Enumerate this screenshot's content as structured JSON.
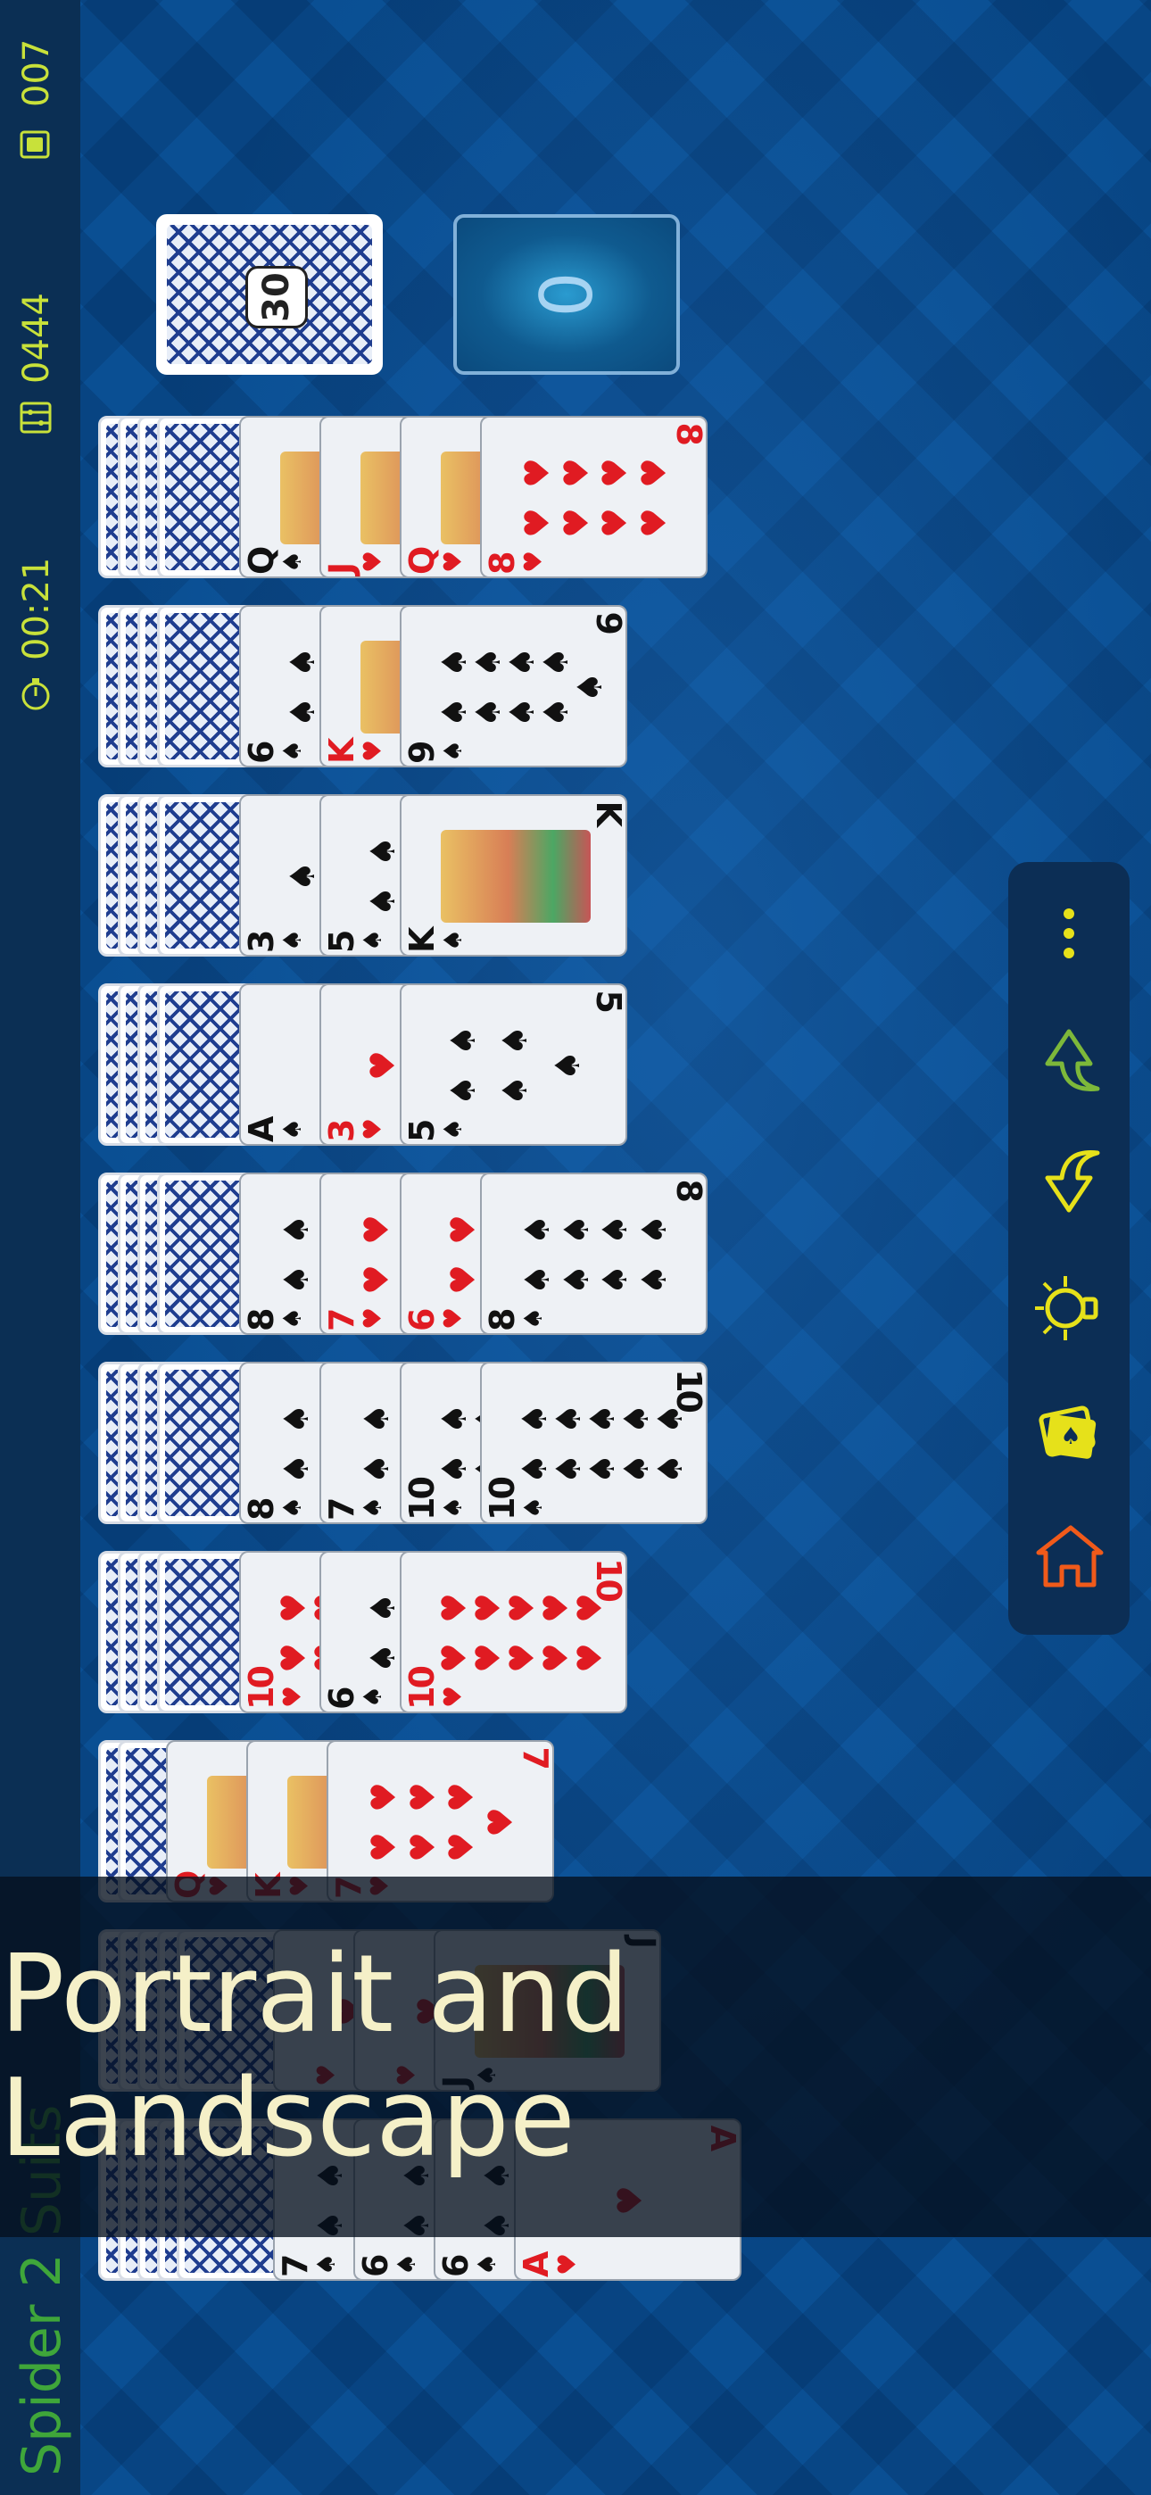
{
  "status": {
    "moves": "007",
    "score": "0444",
    "time": "00:21",
    "game_title": "Spider 2 Suits",
    "moves_icon": "cards-icon",
    "score_icon": "abacus-icon",
    "time_icon": "stopwatch-icon"
  },
  "stock": {
    "count": "30"
  },
  "foundation": {
    "count": "0"
  },
  "tableau": [
    {
      "hidden": 4,
      "face_up": [
        {
          "rank": "Q",
          "suit": "♠",
          "color": "black",
          "court": true
        },
        {
          "rank": "J",
          "suit": "♥",
          "color": "red",
          "court": true
        },
        {
          "rank": "Q",
          "suit": "♥",
          "color": "red",
          "court": true
        },
        {
          "rank": "8",
          "suit": "♥",
          "color": "red"
        }
      ]
    },
    {
      "hidden": 4,
      "face_up": [
        {
          "rank": "6",
          "suit": "♠",
          "color": "black"
        },
        {
          "rank": "K",
          "suit": "♥",
          "color": "red",
          "court": true
        },
        {
          "rank": "9",
          "suit": "♠",
          "color": "black"
        }
      ]
    },
    {
      "hidden": 4,
      "face_up": [
        {
          "rank": "3",
          "suit": "♠",
          "color": "black"
        },
        {
          "rank": "5",
          "suit": "♠",
          "color": "black"
        },
        {
          "rank": "K",
          "suit": "♠",
          "color": "black",
          "court": true
        }
      ]
    },
    {
      "hidden": 4,
      "face_up": [
        {
          "rank": "A",
          "suit": "♠",
          "color": "black"
        },
        {
          "rank": "3",
          "suit": "♥",
          "color": "red"
        },
        {
          "rank": "5",
          "suit": "♠",
          "color": "black"
        }
      ]
    },
    {
      "hidden": 4,
      "face_up": [
        {
          "rank": "8",
          "suit": "♠",
          "color": "black"
        },
        {
          "rank": "7",
          "suit": "♥",
          "color": "red"
        },
        {
          "rank": "6",
          "suit": "♥",
          "color": "red"
        },
        {
          "rank": "8",
          "suit": "♠",
          "color": "black"
        }
      ]
    },
    {
      "hidden": 4,
      "face_up": [
        {
          "rank": "8",
          "suit": "♠",
          "color": "black"
        },
        {
          "rank": "7",
          "suit": "♠",
          "color": "black"
        },
        {
          "rank": "10",
          "suit": "♠",
          "color": "black"
        },
        {
          "rank": "10",
          "suit": "♠",
          "color": "black"
        }
      ]
    },
    {
      "hidden": 4,
      "face_up": [
        {
          "rank": "10",
          "suit": "♥",
          "color": "red"
        },
        {
          "rank": "6",
          "suit": "♠",
          "color": "black"
        },
        {
          "rank": "10",
          "suit": "♥",
          "color": "red"
        }
      ]
    },
    {
      "hidden": 2,
      "face_up": [
        {
          "rank": "Q",
          "suit": "♥",
          "color": "red",
          "court": true
        },
        {
          "rank": "K",
          "suit": "♥",
          "color": "red",
          "court": true
        },
        {
          "rank": "7",
          "suit": "♥",
          "color": "red"
        }
      ]
    },
    {
      "hidden": 5,
      "face_up": [
        {
          "rank": "",
          "suit": "♥",
          "color": "red"
        },
        {
          "rank": "",
          "suit": "♥",
          "color": "red"
        },
        {
          "rank": "J",
          "suit": "♠",
          "color": "black",
          "court": true
        }
      ]
    },
    {
      "hidden": 5,
      "face_up": [
        {
          "rank": "7",
          "suit": "♠",
          "color": "black"
        },
        {
          "rank": "6",
          "suit": "♠",
          "color": "black"
        },
        {
          "rank": "6",
          "suit": "♠",
          "color": "black"
        },
        {
          "rank": "A",
          "suit": "♥",
          "color": "red"
        }
      ]
    }
  ],
  "actions": [
    {
      "name": "menu-button",
      "icon": "more-vertical-icon",
      "color": "#e6e11a"
    },
    {
      "name": "undo-button",
      "icon": "undo-arrow-icon",
      "color": "#7db83a"
    },
    {
      "name": "redo-button",
      "icon": "redo-arrow-icon",
      "color": "#e6e11a"
    },
    {
      "name": "hint-button",
      "icon": "lightbulb-icon",
      "color": "#e6e11a"
    },
    {
      "name": "deal-button",
      "icon": "cards-icon",
      "color": "#e6e11a"
    },
    {
      "name": "home-button",
      "icon": "home-icon",
      "color": "#f05a1a"
    }
  ],
  "promo": {
    "text": "Portrait and Landscape"
  },
  "colors": {
    "accent": "#c8e13a",
    "title_green": "#3fa63a",
    "red_suit": "#e01b22"
  }
}
